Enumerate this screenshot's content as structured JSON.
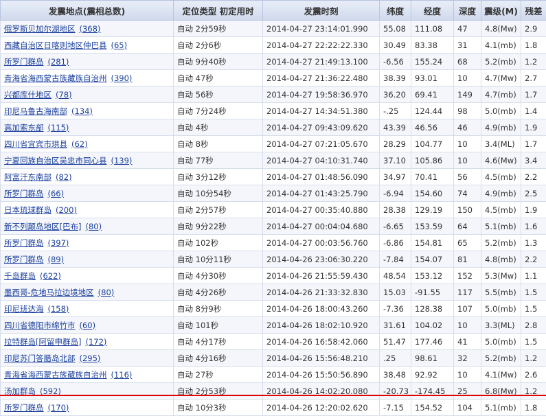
{
  "headers": [
    "发震地点(震相总数)",
    "定位类型 初定用时",
    "发震时刻",
    "纬度",
    "经度",
    "深度",
    "震级(M)",
    "残差"
  ],
  "rows": [
    {
      "place": "俄罗斯贝加尔湖地区",
      "count": "(368)",
      "loc": "自动 2分59秒",
      "time": "2014-04-27 23:14:01.990",
      "lat": "55.08",
      "lon": "111.08",
      "depth": "47",
      "mag": "4.8(Mw)",
      "res": "2.9"
    },
    {
      "place": "西藏自治区日喀则地区仲巴县",
      "count": "(65)",
      "loc": "自动 2分6秒",
      "time": "2014-04-27 22:22:22.330",
      "lat": "30.49",
      "lon": "83.38",
      "depth": "31",
      "mag": "4.1(mb)",
      "res": "1.8"
    },
    {
      "place": "所罗门群岛",
      "count": "(281)",
      "loc": "自动 9分40秒",
      "time": "2014-04-27 21:49:13.100",
      "lat": "-6.56",
      "lon": "155.24",
      "depth": "68",
      "mag": "5.2(mb)",
      "res": "1.2"
    },
    {
      "place": "青海省海西蒙古族藏族自治州",
      "count": "(390)",
      "loc": "自动 47秒",
      "time": "2014-04-27 21:36:22.480",
      "lat": "38.39",
      "lon": "93.01",
      "depth": "10",
      "mag": "4.7(Mw)",
      "res": "2.7"
    },
    {
      "place": "兴都库什地区",
      "count": "(78)",
      "loc": "自动 56秒",
      "time": "2014-04-27 19:58:36.970",
      "lat": "36.20",
      "lon": "69.41",
      "depth": "149",
      "mag": "4.7(mb)",
      "res": "1.7"
    },
    {
      "place": "印尼马鲁古海南部",
      "count": "(134)",
      "loc": "自动 7分24秒",
      "time": "2014-04-27 14:34:51.380",
      "lat": "-.25",
      "lon": "124.44",
      "depth": "98",
      "mag": "5.0(mb)",
      "res": "1.4"
    },
    {
      "place": "高加索东部",
      "count": "(115)",
      "loc": "自动 4秒",
      "time": "2014-04-27 09:43:09.620",
      "lat": "43.39",
      "lon": "46.56",
      "depth": "46",
      "mag": "4.9(mb)",
      "res": "1.9"
    },
    {
      "place": "四川省宜宾市珙县",
      "count": "(62)",
      "loc": "自动 8秒",
      "time": "2014-04-27 07:21:05.670",
      "lat": "28.29",
      "lon": "104.77",
      "depth": "10",
      "mag": "3.4(ML)",
      "res": "1.7"
    },
    {
      "place": "宁夏回族自治区吴忠市同心县",
      "count": "(139)",
      "loc": "自动 77秒",
      "time": "2014-04-27 04:10:31.740",
      "lat": "37.10",
      "lon": "105.86",
      "depth": "10",
      "mag": "4.6(Mw)",
      "res": "3.4"
    },
    {
      "place": "阿富汗东南部",
      "count": "(82)",
      "loc": "自动 3分12秒",
      "time": "2014-04-27 01:48:56.090",
      "lat": "34.97",
      "lon": "70.41",
      "depth": "56",
      "mag": "4.5(mb)",
      "res": "2.2"
    },
    {
      "place": "所罗门群岛",
      "count": "(66)",
      "loc": "自动 10分54秒",
      "time": "2014-04-27 01:43:25.790",
      "lat": "-6.94",
      "lon": "154.60",
      "depth": "74",
      "mag": "4.9(mb)",
      "res": "2.5"
    },
    {
      "place": "日本琉球群岛",
      "count": "(200)",
      "loc": "自动 2分57秒",
      "time": "2014-04-27 00:35:40.880",
      "lat": "28.38",
      "lon": "129.19",
      "depth": "150",
      "mag": "4.5(mb)",
      "res": "1.9"
    },
    {
      "place": "新不列颠岛地区[巴布]",
      "count": "(80)",
      "loc": "自动 9分22秒",
      "time": "2014-04-27 00:04:04.680",
      "lat": "-6.65",
      "lon": "153.59",
      "depth": "64",
      "mag": "5.1(mb)",
      "res": "1.6"
    },
    {
      "place": "所罗门群岛",
      "count": "(397)",
      "loc": "自动 102秒",
      "time": "2014-04-27 00:03:56.760",
      "lat": "-6.86",
      "lon": "154.81",
      "depth": "65",
      "mag": "5.2(mb)",
      "res": "1.3"
    },
    {
      "place": "所罗门群岛",
      "count": "(89)",
      "loc": "自动 10分11秒",
      "time": "2014-04-26 23:06:30.220",
      "lat": "-7.84",
      "lon": "154.07",
      "depth": "81",
      "mag": "4.8(mb)",
      "res": "2.2"
    },
    {
      "place": "千岛群岛",
      "count": "(622)",
      "loc": "自动 4分30秒",
      "time": "2014-04-26 21:55:59.430",
      "lat": "48.54",
      "lon": "153.12",
      "depth": "152",
      "mag": "5.3(Mw)",
      "res": "1.1"
    },
    {
      "place": "墨西哥-危地马拉边境地区",
      "count": "(80)",
      "loc": "自动 4分26秒",
      "time": "2014-04-26 21:33:32.830",
      "lat": "15.03",
      "lon": "-91.55",
      "depth": "117",
      "mag": "5.5(mb)",
      "res": "1.5"
    },
    {
      "place": "印尼班达海",
      "count": "(158)",
      "loc": "自动 8分9秒",
      "time": "2014-04-26 18:00:43.260",
      "lat": "-7.36",
      "lon": "128.38",
      "depth": "107",
      "mag": "5.0(mb)",
      "res": "1.5"
    },
    {
      "place": "四川省德阳市绵竹市",
      "count": "(60)",
      "loc": "自动 101秒",
      "time": "2014-04-26 18:02:10.920",
      "lat": "31.61",
      "lon": "104.02",
      "depth": "10",
      "mag": "3.3(ML)",
      "res": "2.8"
    },
    {
      "place": "拉特群岛[阿留申群岛]",
      "count": "(172)",
      "loc": "自动 4分17秒",
      "time": "2014-04-26 16:58:42.060",
      "lat": "51.47",
      "lon": "177.46",
      "depth": "41",
      "mag": "5.0(mb)",
      "res": "1.5"
    },
    {
      "place": "印尼苏门答腊岛北部",
      "count": "(295)",
      "loc": "自动 4分16秒",
      "time": "2014-04-26 15:56:48.210",
      "lat": ".25",
      "lon": "98.61",
      "depth": "32",
      "mag": "5.2(mb)",
      "res": "1.2"
    },
    {
      "place": "青海省海西蒙古族藏族自治州",
      "count": "(116)",
      "loc": "自动 27秒",
      "time": "2014-04-26 15:50:56.890",
      "lat": "38.48",
      "lon": "92.92",
      "depth": "10",
      "mag": "4.1(Mw)",
      "res": "2.6"
    },
    {
      "place": "汤加群岛",
      "count": "(592)",
      "loc": "自动 2分53秒",
      "time": "2014-04-26 14:02:20.080",
      "lat": "-20.73",
      "lon": "-174.45",
      "depth": "25",
      "mag": "6.8(Mw)",
      "res": "1.2"
    },
    {
      "place": "所罗门群岛",
      "count": "(170)",
      "loc": "自动 10分3秒",
      "time": "2014-04-26 12:20:02.620",
      "lat": "-7.15",
      "lon": "154.52",
      "depth": "104",
      "mag": "5.1(mb)",
      "res": "1.8"
    }
  ],
  "colors": {
    "header_bg": "#d9e1f2",
    "link": "#1a3f9c",
    "highlight_line": "#e00000"
  }
}
